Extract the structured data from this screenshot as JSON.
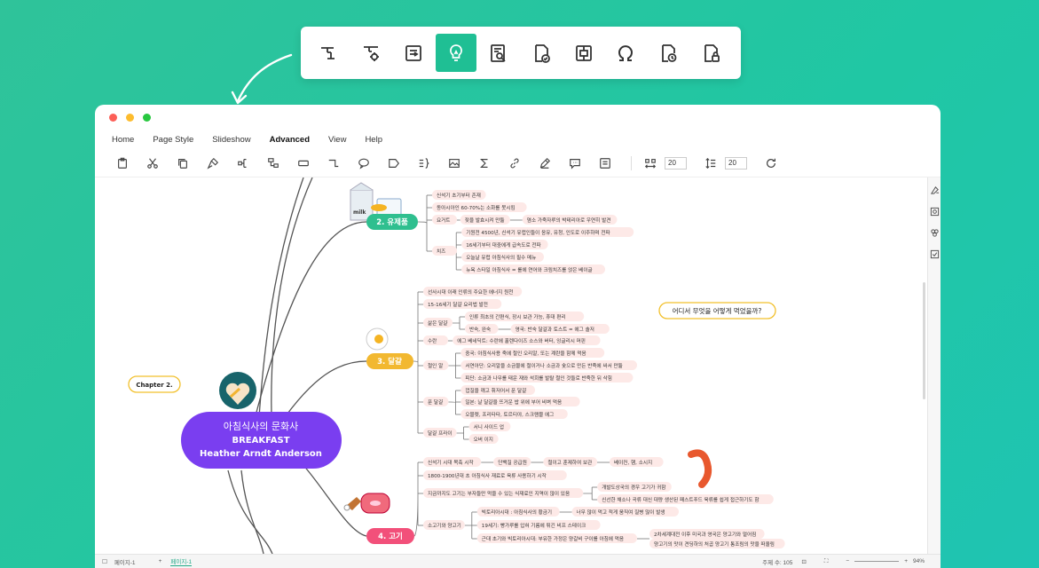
{
  "float_toolbar": {
    "buttons": [
      {
        "icon": "topic-structure-icon",
        "active": false
      },
      {
        "icon": "topic-settings-icon",
        "active": false
      },
      {
        "icon": "insert-relationship-icon",
        "active": false
      },
      {
        "icon": "idea-bulb-icon",
        "active": true
      },
      {
        "icon": "find-replace-icon",
        "active": false
      },
      {
        "icon": "spell-check-icon",
        "active": false
      },
      {
        "icon": "topic-frame-icon",
        "active": false
      },
      {
        "icon": "symbol-omega-icon",
        "active": false
      },
      {
        "icon": "history-icon",
        "active": false
      },
      {
        "icon": "lock-document-icon",
        "active": false
      }
    ],
    "accent": "#1fbf94"
  },
  "window": {
    "menu": [
      "Home",
      "Page Style",
      "Slideshow",
      "Advanced",
      "View",
      "Help"
    ],
    "active_menu": "Advanced",
    "toolbar": {
      "spacing_h": "20",
      "spacing_v": "20"
    },
    "statusbar": {
      "page_label": "페이지-1",
      "tab_label": "페이지-1",
      "topic_count": "주제 수: 105",
      "zoom": "94%"
    }
  },
  "mindmap": {
    "central": {
      "line1": "아침식사의 문화사",
      "line2": "BREAKFAST",
      "line3": "Heather Arndt Anderson",
      "color": "#7a3ef0"
    },
    "chapter_label": "Chapter 2.",
    "callout": "어디서 무엇을 어떻게 먹었을까?",
    "branches": {
      "dairy": {
        "label": "2. 유제품",
        "color": "#2fbf8f",
        "items": [
          "신석기 초기부터 존재",
          "동아시아인 60-70%는 소화를 못시킴",
          "요거트",
          "치즈"
        ],
        "yogurt": [
          "젖을 발효시켜 만듦",
          "염소 가죽자루의 박테리아로 우연히 발견"
        ],
        "cheese": [
          "기원전 4500년, 신석기 유럽인들이 응유, 유청, 인도로 이주하며 전파",
          "16세기부터 대중에게 급속도로 전파",
          "오늘날 유럽 아침식사의 필수 메뉴",
          "뉴욕 스타일 아침식사 = 롤에 연어와 크림치즈를 얹은 베이글"
        ]
      },
      "egg": {
        "label": "3. 달걀",
        "color": "#f2b830",
        "items": [
          "선사시대 이래 인류의 주요한 에너지 원천",
          "15-16세기 달걀 요리법 발전",
          "삶은 달걀",
          "수란",
          "절인 알",
          "푼 달걀",
          "달걀 프라이"
        ],
        "boiled": [
          "인류 최초의 간편식, 장시 보관 가능, 휴대 편리",
          "반숙, 완숙",
          "영국: 반숙 달걀과 토스트 = 에그 솔저"
        ],
        "poached": [
          "에그 베네딕트: 수란에 홀렌다이즈 소스와 버터, 잉글리시 머핀"
        ],
        "pickled": [
          "중국: 아침식사용 죽에 절인 오리알, 또는 계란을 함께 먹음",
          "서연아단: 오리알을 소금물에 절이거나 소금과 숯으로 만든 반죽에 싸서 만듦",
          "피단: 소금과 나무를 태운 재와 석회를 발랄 절인 것들로 반죽한 뒤 삭힘"
        ],
        "scrambled": [
          "껍질을 깨고 휘저어서 푼 달걀",
          "일본: 날 달걀을 뜨거운 밥 위에 부어 비벼 먹음",
          "오믈렛, 프리타타, 토르티야, 스크램블 에그"
        ],
        "fried": [
          "서니 사이드 업",
          "오버 이지"
        ]
      },
      "meat": {
        "label": "4. 고기",
        "color": "#f2507a",
        "items": [
          "신석기 시대 목축 시작",
          "1800-1900년대 초 아침식사 재료로 육류 사용하기 시작",
          "지금까지도 고기는 부자들만 먹을 수 있는 식재료인 지역이 많이 있음",
          "소고기와 양고기"
        ],
        "first": [
          "단백질 공급원",
          "절이고 훈제하여 보관",
          "베이컨, 햄, 소시지"
        ],
        "third": [
          "개발도상국의 경우 고기가 귀함",
          "신선한 채소나 곡류 대신 대량 생산된 패스트푸드 육류를 쉽게 접근하기도 함"
        ],
        "beef": [
          "빅토리아시대 : 아침식사의 황금기",
          "너무 많이 먹고 적게 움직여 질병 많이 발생",
          "19세기: 빵가루를 입혀 기름에 튀긴 비프 스테이크",
          "근대 초기와 빅토리아시대: 부유한 가정은 양갈비 구이를 아침에 먹음",
          "2차세계대전 이후 미국과 영국은 양고기와 멀어짐",
          "양고기의 맛이 견딩하의 처곱 양고기 통조림의 맛을 떠올림"
        ]
      }
    },
    "leaf_bg": "#fde9e7"
  }
}
